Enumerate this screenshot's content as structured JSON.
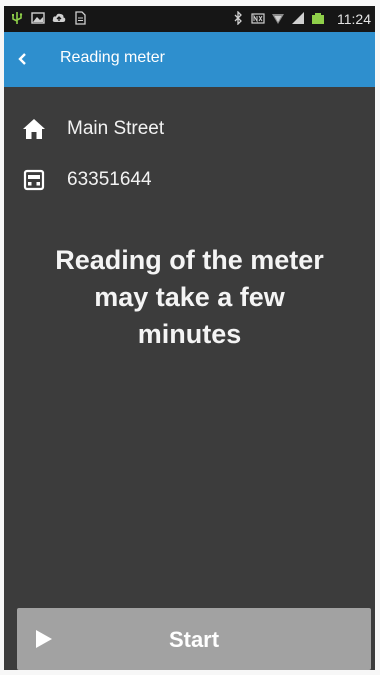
{
  "status_bar": {
    "time": "11:24",
    "left_icons": [
      "usb-icon",
      "image-icon",
      "cloud-upload-icon",
      "file-icon"
    ],
    "right_icons": [
      "bluetooth-icon",
      "nfc-icon",
      "wifi-icon",
      "signal-icon",
      "battery-icon"
    ]
  },
  "app_bar": {
    "title": "Reading meter",
    "back_icon": "chevron-left-icon",
    "color": "#2e8fce"
  },
  "info": {
    "address": "Main Street",
    "address_icon": "home-icon",
    "meter_number": "63351644",
    "meter_icon": "meter-icon"
  },
  "message": {
    "line1": "Reading of the meter",
    "line2": "may take a few",
    "line3": "minutes"
  },
  "start_button": {
    "label": "Start",
    "icon": "play-icon"
  }
}
